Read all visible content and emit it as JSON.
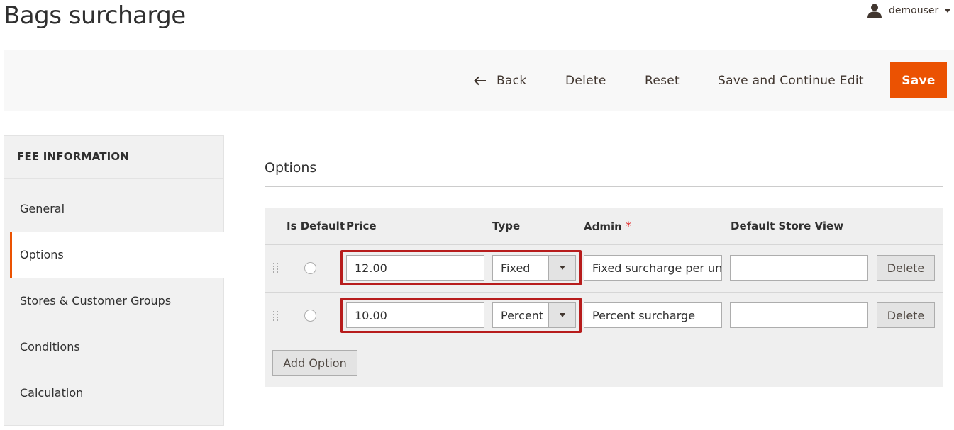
{
  "page": {
    "title": "Bags surcharge"
  },
  "user": {
    "name": "demouser"
  },
  "toolbar": {
    "back_label": "Back",
    "delete_label": "Delete",
    "reset_label": "Reset",
    "save_continue_label": "Save and Continue Edit",
    "save_label": "Save"
  },
  "sidebar": {
    "title": "FEE INFORMATION",
    "items": [
      {
        "label": "General"
      },
      {
        "label": "Options"
      },
      {
        "label": "Stores & Customer Groups"
      },
      {
        "label": "Conditions"
      },
      {
        "label": "Calculation"
      }
    ]
  },
  "options": {
    "section_title": "Options",
    "columns": {
      "is_default": "Is Default",
      "price": "Price",
      "type": "Type",
      "admin": "Admin",
      "admin_required": "*",
      "default_store_view": "Default Store View"
    },
    "rows": [
      {
        "price": "12.00",
        "type": "Fixed",
        "admin": "Fixed surcharge per uni",
        "store_view": "",
        "delete_label": "Delete"
      },
      {
        "price": "10.00",
        "type": "Percent",
        "admin": "Percent surcharge",
        "store_view": "",
        "delete_label": "Delete"
      }
    ],
    "add_option_label": "Add Option"
  },
  "colors": {
    "accent": "#eb5202",
    "highlight_box": "#b71c1c",
    "required_star": "#e22626"
  }
}
